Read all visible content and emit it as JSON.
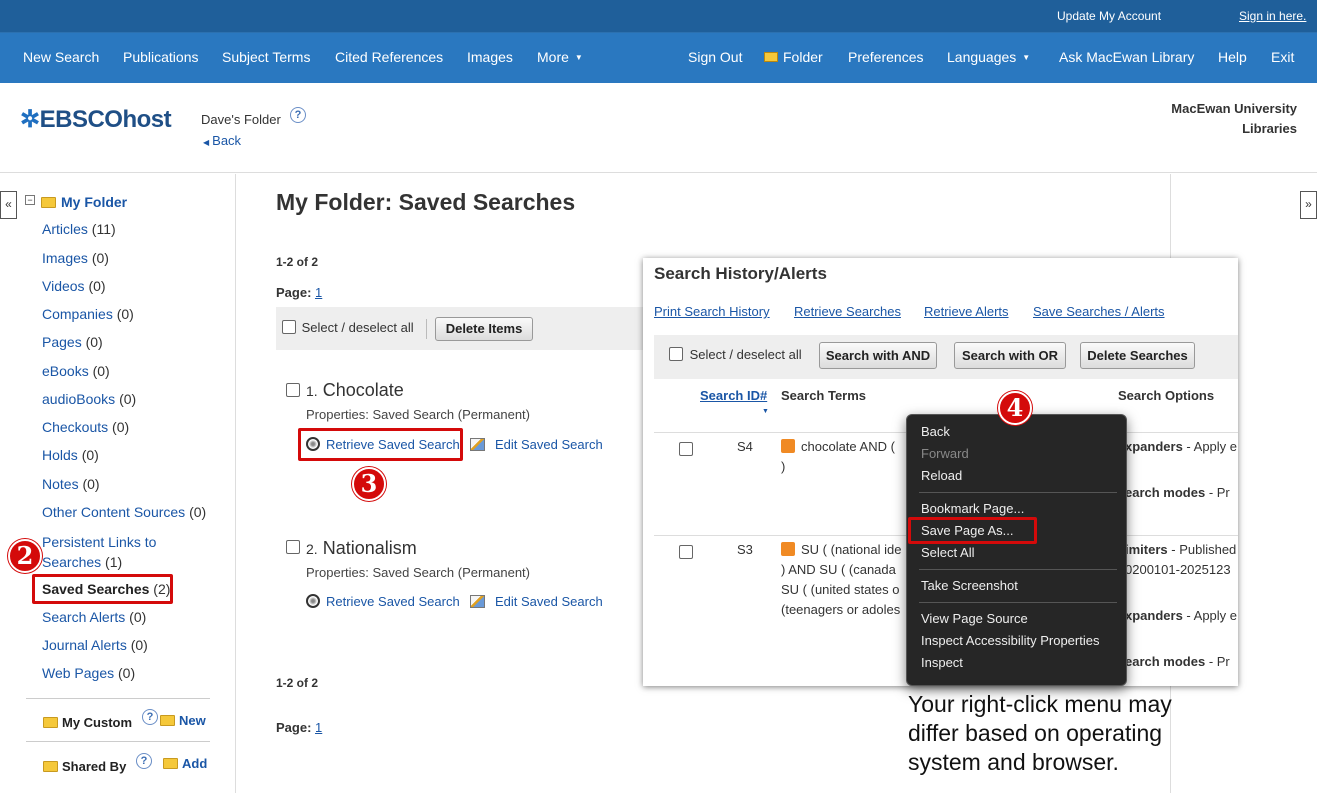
{
  "topbar": {
    "update_account": "Update My Account",
    "sign_in": "Sign in here."
  },
  "nav": {
    "left": [
      "New Search",
      "Publications",
      "Subject Terms",
      "Cited References",
      "Images",
      "More"
    ],
    "right": [
      "Sign Out",
      "Folder",
      "Preferences",
      "Languages",
      "Ask MacEwan Library",
      "Help",
      "Exit"
    ]
  },
  "header": {
    "logo": "EBSCOhost",
    "folder_title": "Dave's Folder",
    "back": "Back",
    "institution_line1": "MacEwan University",
    "institution_line2": "Libraries"
  },
  "sidebar": {
    "my_folder": "My Folder",
    "items": [
      {
        "label": "Articles",
        "count": "(11)"
      },
      {
        "label": "Images",
        "count": "(0)"
      },
      {
        "label": "Videos",
        "count": "(0)"
      },
      {
        "label": "Companies",
        "count": "(0)"
      },
      {
        "label": "Pages",
        "count": "(0)"
      },
      {
        "label": "eBooks",
        "count": "(0)"
      },
      {
        "label": "audioBooks",
        "count": "(0)"
      },
      {
        "label": "Checkouts",
        "count": "(0)"
      },
      {
        "label": "Holds",
        "count": "(0)"
      },
      {
        "label": "Notes",
        "count": "(0)"
      },
      {
        "label": "Other Content Sources",
        "count": "(0)"
      },
      {
        "label": "Persistent Links to",
        "label2": "Searches",
        "count": "(1)"
      },
      {
        "label": "Saved Searches",
        "count": "(2)"
      },
      {
        "label": "Search Alerts",
        "count": "(0)"
      },
      {
        "label": "Journal Alerts",
        "count": "(0)"
      },
      {
        "label": "Web Pages",
        "count": "(0)"
      }
    ],
    "my_custom": "My Custom",
    "new": "New",
    "shared_by": "Shared By",
    "add": "Add",
    "collapse_left": "«",
    "collapse_right": "»"
  },
  "main": {
    "title": "My Folder: Saved Searches",
    "range": "1-2 of 2",
    "page_label": "Page:",
    "page_num": "1",
    "select_all": "Select / deselect all",
    "delete_items": "Delete Items",
    "results": [
      {
        "num": "1.",
        "title": "Chocolate",
        "props": "Properties: Saved Search (Permanent)",
        "retrieve": "Retrieve Saved Search",
        "edit": "Edit Saved Search"
      },
      {
        "num": "2.",
        "title": "Nationalism",
        "props": "Properties: Saved Search (Permanent)",
        "retrieve": "Retrieve Saved Search",
        "edit": "Edit Saved Search"
      }
    ]
  },
  "history": {
    "title": "Search History/Alerts",
    "links": [
      "Print Search History",
      "Retrieve Searches",
      "Retrieve Alerts",
      "Save Searches / Alerts"
    ],
    "select_all": "Select / deselect all",
    "buttons": [
      "Search with AND",
      "Search with OR",
      "Delete Searches"
    ],
    "columns": [
      "Search ID#",
      "Search Terms",
      "Search Options"
    ],
    "rows": [
      {
        "id": "S4",
        "terms": [
          "chocolate AND (",
          ")"
        ],
        "opt1_b": "xpanders",
        "opt1": " - Apply e",
        "opt2_b": "earch modes",
        "opt2": " - Pr"
      },
      {
        "id": "S3",
        "terms": [
          "SU ( (national ide",
          ") AND SU ( (canada",
          "SU ( (united states o",
          "(teenagers or adoles"
        ],
        "opt1_b": "imiters",
        "opt1": " - Published",
        "opt1b": "0200101-2025123",
        "opt2_b": "xpanders",
        "opt2": " - Apply e",
        "opt3_b": "earch modes",
        "opt3": " - Pr"
      }
    ]
  },
  "context_menu": {
    "items": [
      "Back",
      "Forward",
      "Reload",
      "Bookmark Page...",
      "Save Page As...",
      "Select All",
      "Take Screenshot",
      "View Page Source",
      "Inspect Accessibility Properties",
      "Inspect"
    ]
  },
  "badges": [
    "2",
    "3",
    "4"
  ],
  "note": "Your right-click menu may differ based on operating system and browser.",
  "colors": {
    "topbar": "#1f5f9a",
    "navbar": "#2a78c0",
    "link": "#1a56a6",
    "highlight": "#d40a0a",
    "menu_bg": "#262626"
  }
}
